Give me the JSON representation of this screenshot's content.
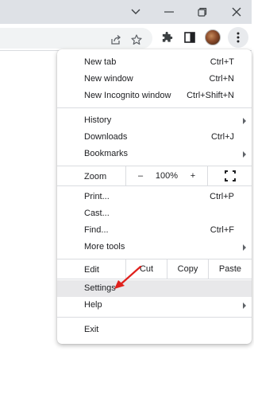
{
  "title_bar": {
    "buttons": [
      {
        "icon": "chevron-down-icon"
      },
      {
        "icon": "minimize-icon"
      },
      {
        "icon": "restore-icon"
      },
      {
        "icon": "close-icon"
      }
    ]
  },
  "toolbar": {
    "omnibox_icons": [
      "share-icon",
      "bookmark-star-icon"
    ],
    "icons": [
      "extensions-icon",
      "side-panel-icon",
      "profile-avatar",
      "kebab-menu-icon"
    ]
  },
  "menu": {
    "new_tab": {
      "label": "New tab",
      "shortcut": "Ctrl+T"
    },
    "new_window": {
      "label": "New window",
      "shortcut": "Ctrl+N"
    },
    "new_incognito": {
      "label": "New Incognito window",
      "shortcut": "Ctrl+Shift+N"
    },
    "history": {
      "label": "History"
    },
    "downloads": {
      "label": "Downloads",
      "shortcut": "Ctrl+J"
    },
    "bookmarks": {
      "label": "Bookmarks"
    },
    "zoom": {
      "label": "Zoom",
      "minus": "–",
      "value": "100%",
      "plus": "+",
      "fullscreen_icon": "fullscreen-icon"
    },
    "print": {
      "label": "Print...",
      "shortcut": "Ctrl+P"
    },
    "cast": {
      "label": "Cast..."
    },
    "find": {
      "label": "Find...",
      "shortcut": "Ctrl+F"
    },
    "more_tools": {
      "label": "More tools"
    },
    "edit": {
      "label": "Edit",
      "cut": "Cut",
      "copy": "Copy",
      "paste": "Paste"
    },
    "settings": {
      "label": "Settings"
    },
    "help": {
      "label": "Help"
    },
    "exit": {
      "label": "Exit"
    }
  },
  "colors": {
    "title_bar": "#dee1e6",
    "highlight": "#e8e8ea",
    "annotation_arrow": "#e0201c"
  }
}
